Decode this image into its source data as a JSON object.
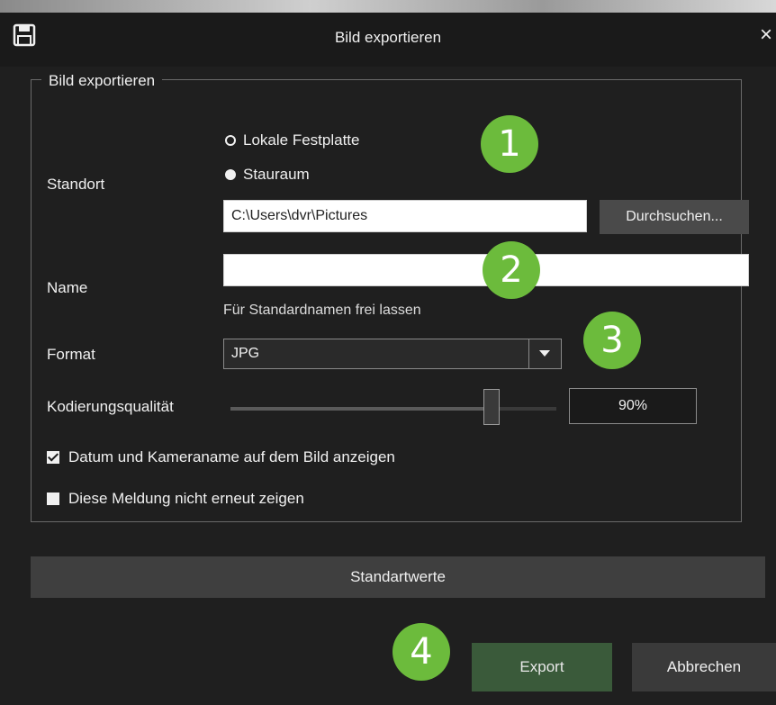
{
  "window": {
    "title": "Bild exportieren",
    "close_glyph": "×",
    "save_icon": "save-icon"
  },
  "group": {
    "legend": "Bild exportieren"
  },
  "location": {
    "label": "Standort",
    "options": [
      {
        "label": "Lokale Festplatte",
        "selected": false
      },
      {
        "label": "Stauraum",
        "selected": true
      }
    ],
    "path_value": "C:\\Users\\dvr\\Pictures",
    "browse_label": "Durchsuchen..."
  },
  "name": {
    "label": "Name",
    "value": "",
    "hint": "Für Standardnamen frei lassen"
  },
  "format": {
    "label": "Format",
    "value": "JPG"
  },
  "quality": {
    "label": "Kodierungsqualität",
    "value_text": "90%",
    "value": 0.8
  },
  "checkboxes": [
    {
      "label": "Datum und Kameraname auf dem Bild anzeigen",
      "checked": true
    },
    {
      "label": "Diese Meldung nicht erneut zeigen",
      "checked": false
    }
  ],
  "buttons": {
    "defaults": "Standartwerte",
    "export": "Export",
    "cancel": "Abbrechen"
  },
  "callouts": [
    "1",
    "2",
    "3",
    "4"
  ],
  "colors": {
    "callout": "#6cbb3c",
    "export": "#3a5a3a",
    "background": "#1f1f1f"
  }
}
